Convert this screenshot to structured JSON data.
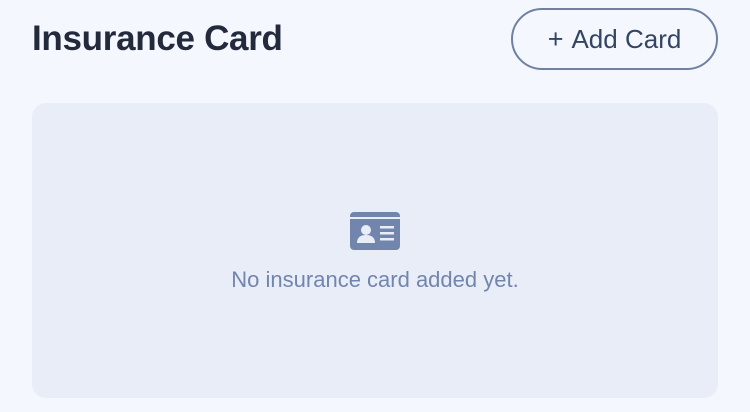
{
  "header": {
    "title": "Insurance Card",
    "add_button_plus": "+",
    "add_button_label": "Add Card"
  },
  "empty_state": {
    "icon": "id-card-icon",
    "message": "No insurance card added yet."
  },
  "colors": {
    "background": "#f4f7fd",
    "panel": "#e9edf7",
    "title": "#232a3b",
    "button_border": "#6f81a3",
    "accent_muted": "#7285ad"
  }
}
